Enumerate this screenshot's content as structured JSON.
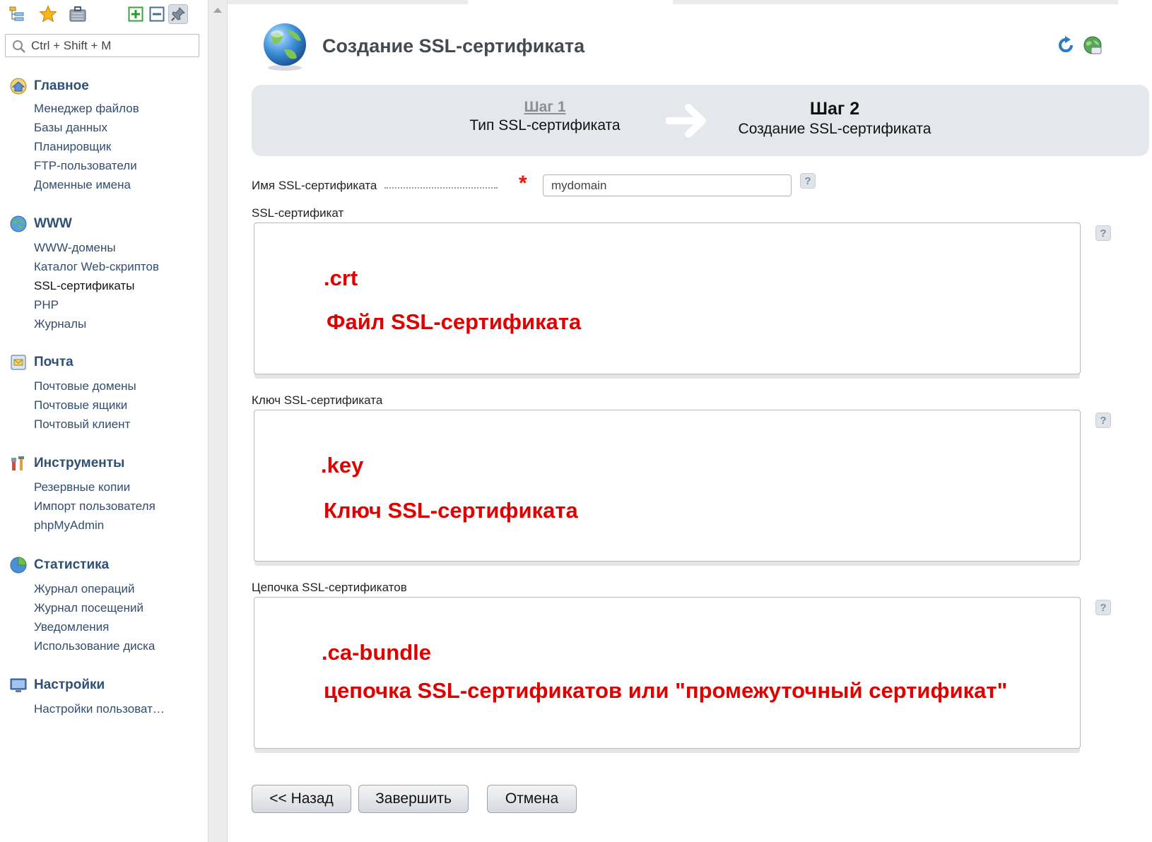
{
  "sidebar": {
    "search_placeholder": "Ctrl + Shift + M",
    "groups": [
      {
        "title": "Главное",
        "icon": "home-icon",
        "items": [
          "Менеджер файлов",
          "Базы данных",
          "Планировщик",
          "FTP-пользователи",
          "Доменные имена"
        ]
      },
      {
        "title": "WWW",
        "icon": "www-globe-icon",
        "items": [
          "WWW-домены",
          "Каталог Web-скриптов",
          "SSL-сертификаты",
          "PHP",
          "Журналы"
        ]
      },
      {
        "title": "Почта",
        "icon": "mail-icon",
        "items": [
          "Почтовые домены",
          "Почтовые ящики",
          "Почтовый клиент"
        ]
      },
      {
        "title": "Инструменты",
        "icon": "tools-icon",
        "items": [
          "Резервные копии",
          "Импорт пользователя",
          "phpMyAdmin"
        ]
      },
      {
        "title": "Статистика",
        "icon": "pie-chart-icon",
        "items": [
          "Журнал операций",
          "Журнал посещений",
          "Уведомления",
          "Использование диска"
        ]
      },
      {
        "title": "Настройки",
        "icon": "monitor-settings-icon",
        "items": [
          "Настройки пользоват…"
        ]
      }
    ],
    "active_item": "SSL-сертификаты"
  },
  "page": {
    "title": "Создание SSL-сертификата"
  },
  "wizard": {
    "step1": {
      "number": "Шаг 1",
      "name": "Тип SSL-сертификата"
    },
    "step2": {
      "number": "Шаг 2",
      "name": "Создание SSL-сертификата"
    }
  },
  "form": {
    "name_label": "Имя SSL-сертификата",
    "name_value": "mydomain",
    "help": "?",
    "cert_label": "SSL-сертификат",
    "cert_ext": ".crt",
    "cert_desc": "Файл SSL-сертификата",
    "key_label": "Ключ SSL-сертификата",
    "key_ext": ".key",
    "key_desc": "Ключ SSL-сертификата",
    "chain_label": "Цепочка SSL-сертификатов",
    "chain_ext": ".ca-bundle",
    "chain_desc": "цепочка SSL-сертификатов или \"промежуточный сертификат\""
  },
  "buttons": {
    "back": "<< Назад",
    "finish": "Завершить",
    "cancel": "Отмена"
  },
  "colors": {
    "accent_red": "#e00000",
    "menu_text": "#334d6e",
    "wizard_bg": "#e4e7eb"
  }
}
